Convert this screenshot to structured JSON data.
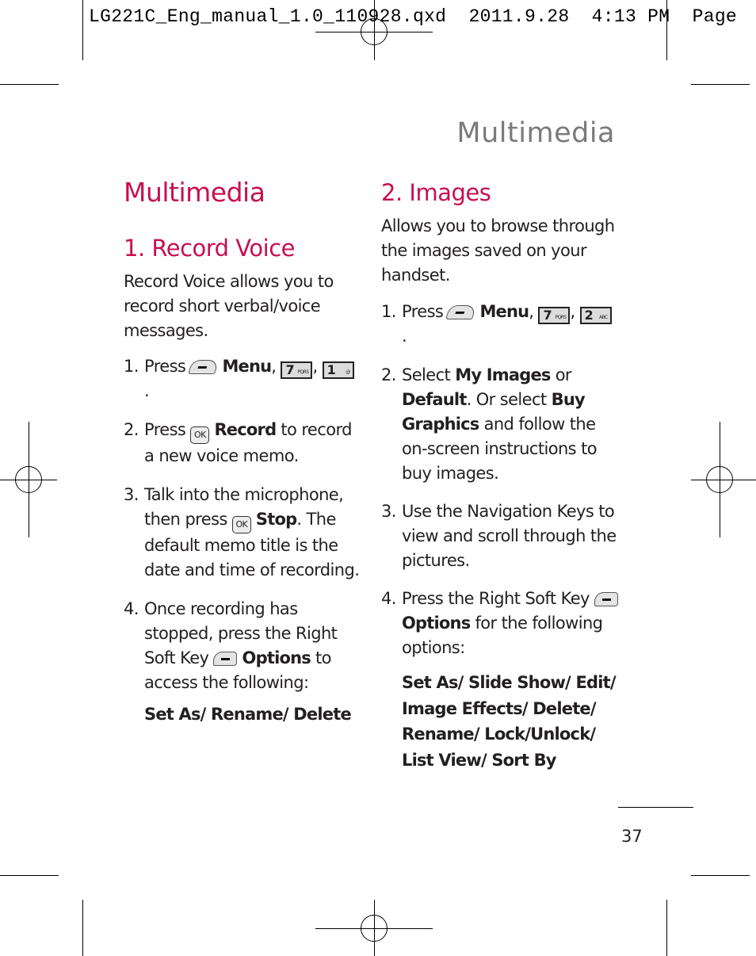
{
  "slug": {
    "filename": "LG221C_Eng_manual_1.0_110928.qxd",
    "date": "2011.9.28",
    "time": "4:13",
    "ampm": "PM",
    "page_label": "Page"
  },
  "running_head": "Multimedia",
  "left_column": {
    "title": "Multimedia",
    "section_title": "1. Record Voice",
    "intro": "Record Voice allows you to record short verbal/voice messages.",
    "steps": [
      {
        "num": "1.",
        "parts": {
          "a": "Press",
          "menu": "Menu",
          "comma": ",",
          "end": "."
        }
      },
      {
        "num": "2.",
        "parts": {
          "a": "Press",
          "bold": "Record",
          "b": "to record a new voice memo."
        }
      },
      {
        "num": "3.",
        "parts": {
          "a": "Talk into the microphone, then press",
          "bold": "Stop",
          "b": ". The default memo title is the date and time of recording."
        }
      },
      {
        "num": "4.",
        "parts": {
          "a": "Once recording has stopped, press the Right Soft Key",
          "bold": "Options",
          "b": "to access the following:"
        }
      }
    ],
    "options_list": "Set As/ Rename/ Delete"
  },
  "right_column": {
    "section_title": "2. Images",
    "intro": "Allows you to browse through the images saved on your handset.",
    "steps": [
      {
        "num": "1.",
        "parts": {
          "a": "Press",
          "menu": "Menu",
          "comma": ",",
          "end": "."
        }
      },
      {
        "num": "2.",
        "parts": {
          "a": "Select",
          "bold1": "My Images",
          "or": "or",
          "bold2": "Default",
          "b": ". Or select",
          "bold3": "Buy Graphics",
          "c": "and follow the on-screen instructions to buy images."
        }
      },
      {
        "num": "3.",
        "parts": {
          "a": "Use the Navigation Keys to view and scroll through the pictures."
        }
      },
      {
        "num": "4.",
        "parts": {
          "a": "Press the Right Soft Key",
          "bold": "Options",
          "b": "for the following options:"
        }
      }
    ],
    "options_list": [
      "Set As/ Slide Show/ Edit/",
      "Image Effects/ Delete/",
      "Rename/ Lock/Unlock/",
      "List View/ Sort By"
    ]
  },
  "keys": {
    "seven": "7",
    "seven_letters": "PQRS",
    "one": "1",
    "one_sub": "@",
    "two": "2",
    "two_letters": "ABC",
    "ok": "OK"
  },
  "page_number": "37"
}
